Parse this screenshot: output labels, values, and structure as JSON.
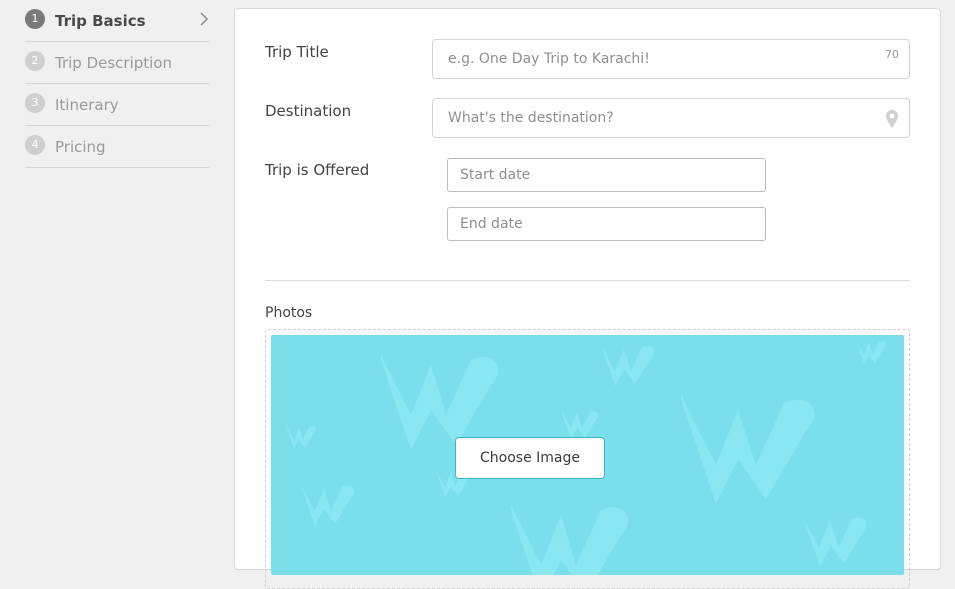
{
  "sidebar": {
    "steps": [
      {
        "number": "1",
        "label": "Trip Basics",
        "active": true
      },
      {
        "number": "2",
        "label": "Trip Description",
        "active": false
      },
      {
        "number": "3",
        "label": "Itinerary",
        "active": false
      },
      {
        "number": "4",
        "label": "Pricing",
        "active": false
      }
    ]
  },
  "form": {
    "trip_title": {
      "label": "Trip Title",
      "placeholder": "e.g. One Day Trip to Karachi!",
      "value": "",
      "char_counter": "70"
    },
    "destination": {
      "label": "Destination",
      "placeholder": "What's the destination?",
      "value": ""
    },
    "offered": {
      "label": "Trip is Offered",
      "start_placeholder": "Start date",
      "end_placeholder": "End date"
    },
    "photos": {
      "label": "Photos",
      "button_label": "Choose Image"
    }
  },
  "colors": {
    "banner": "#7bdfeb",
    "button_border": "#3fb6c6",
    "active_step": "#7a7a7a",
    "inactive_step": "#cfcfcf"
  },
  "icons": [
    "chevron-right-icon",
    "map-pin-icon"
  ]
}
